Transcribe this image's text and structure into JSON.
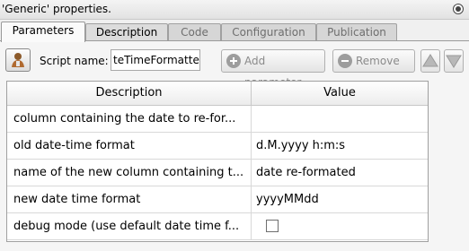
{
  "window": {
    "title": "'Generic' properties."
  },
  "tabs": [
    {
      "label": "Parameters",
      "state": "active"
    },
    {
      "label": "Description",
      "state": "enabled"
    },
    {
      "label": "Code",
      "state": "disabled"
    },
    {
      "label": "Configuration",
      "state": "disabled"
    },
    {
      "label": "Publication",
      "state": "disabled"
    }
  ],
  "toolbar": {
    "script_icon": "script-person-icon",
    "script_name_label": "Script name:",
    "script_name_value": "teTimeFormatter",
    "add_parameter_label": "Add parameter",
    "add_parameter_icon": "plus-circle-icon",
    "remove_label": "Remove",
    "remove_icon": "minus-circle-icon",
    "move_up_icon": "triangle-up-icon",
    "move_down_icon": "triangle-down-icon"
  },
  "table": {
    "headers": {
      "description": "Description",
      "value": "Value"
    },
    "rows": [
      {
        "description": "column containing the date to re-for...",
        "value": ""
      },
      {
        "description": "old date-time format",
        "value": "d.M.yyyy h:m:s"
      },
      {
        "description": "name of the new column containing t...",
        "value": "date re-formated"
      },
      {
        "description": "new date time format",
        "value": "yyyyMMdd"
      },
      {
        "description": "debug mode (use default date time f...",
        "value_checkbox": false
      }
    ]
  },
  "colors": {
    "tab_active_bg": "#fafafa",
    "tab_inactive_bg": "#d6d6d6",
    "disabled_text": "#8a8a8a"
  }
}
